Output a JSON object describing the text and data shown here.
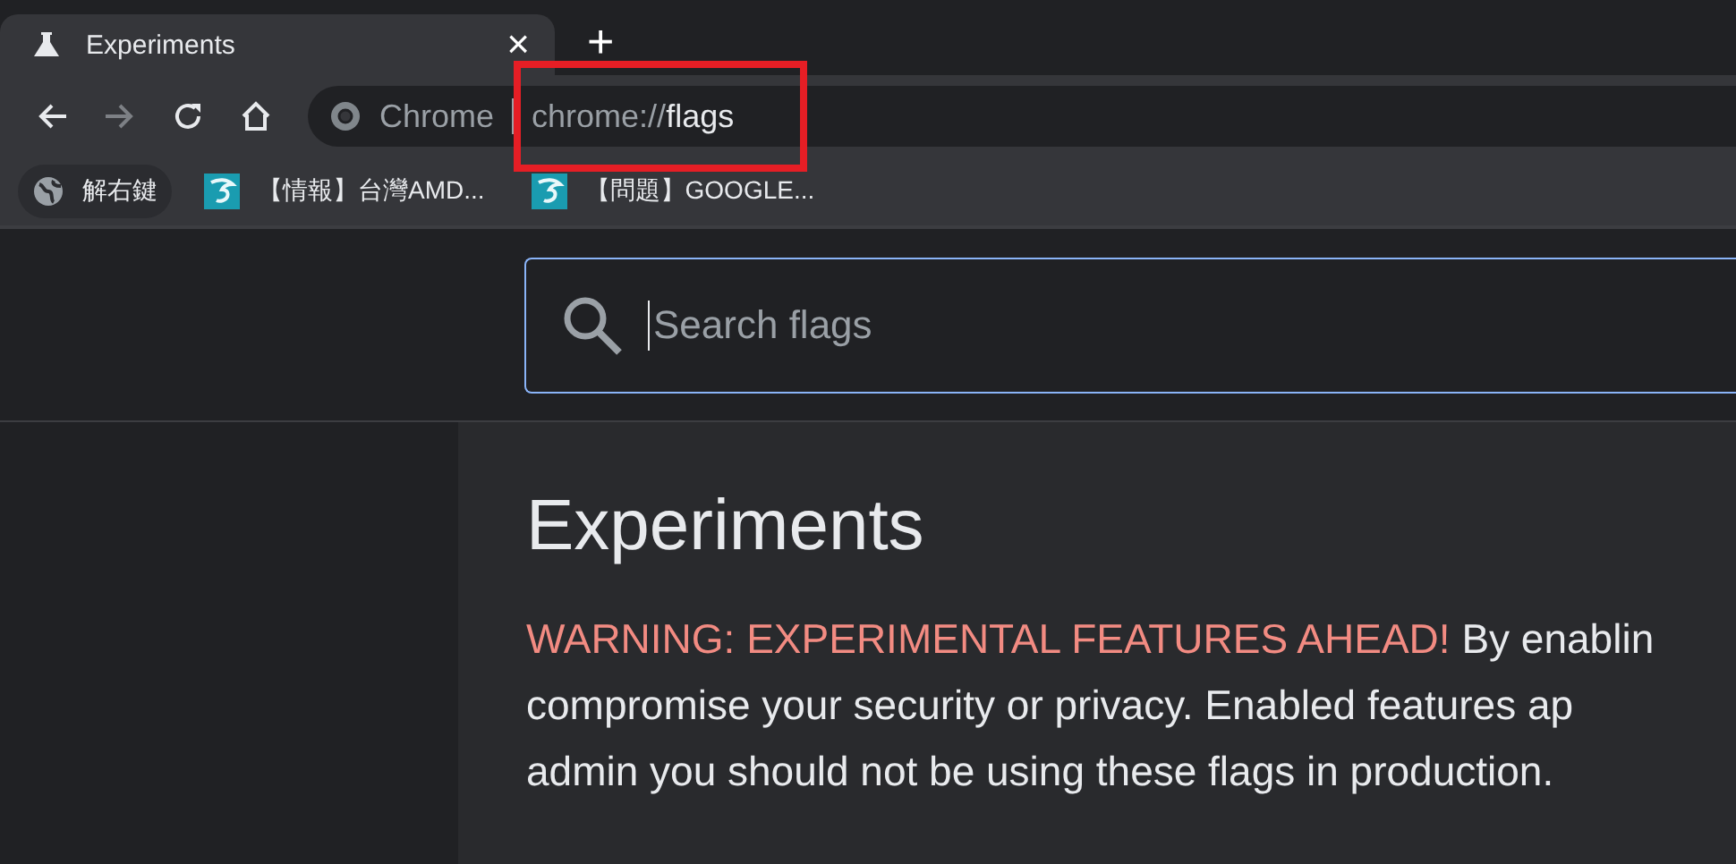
{
  "tab": {
    "title": "Experiments",
    "close": "×",
    "selected": true
  },
  "new_tab": "+",
  "omnibox": {
    "site_label": "Chrome",
    "url_prefix": "chrome://",
    "url_path": "flags"
  },
  "bookmarks": [
    {
      "kind": "globe",
      "label": "解右鍵"
    },
    {
      "kind": "site",
      "label": "【情報】台灣AMD..."
    },
    {
      "kind": "site",
      "label": "【問題】GOOGLE..."
    }
  ],
  "search": {
    "placeholder": "Search flags"
  },
  "heading": "Experiments",
  "warning": {
    "highlight": "WARNING: EXPERIMENTAL FEATURES AHEAD!",
    "lines": [
      "By enablin",
      "compromise your security or privacy. Enabled features ap",
      "admin you should not be using these flags in production."
    ]
  }
}
